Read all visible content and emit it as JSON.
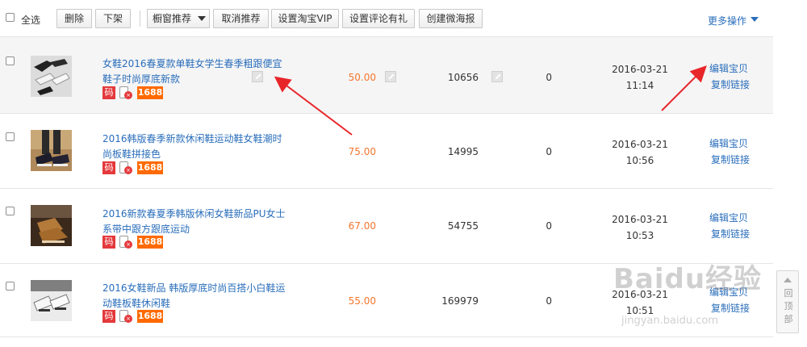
{
  "toolbar": {
    "select_all": "全选",
    "buttons": [
      "删除",
      "下架",
      "橱窗推荐",
      "取消推荐",
      "设置淘宝VIP",
      "设置评论有礼",
      "创建微海报"
    ],
    "more": "更多操作"
  },
  "badges": {
    "ma": "码",
    "x": "×",
    "b1688": "1688"
  },
  "rows": [
    {
      "title": "女鞋2016春夏款单鞋女学生春季粗跟便宜鞋子时尚厚底新款",
      "price": "50.00",
      "stock": "10656",
      "sales": "0",
      "date": "2016-03-21",
      "time": "11:14",
      "edit": "编辑宝贝",
      "copy": "复制链接"
    },
    {
      "title": "2016韩版春季新款休闲鞋运动鞋女鞋潮时尚板鞋拼接色",
      "price": "75.00",
      "stock": "14995",
      "sales": "0",
      "date": "2016-03-21",
      "time": "10:56",
      "edit": "编辑宝贝",
      "copy": "复制链接"
    },
    {
      "title": "2016新款春夏季韩版休闲女鞋新品PU女士系带中跟方跟底运动",
      "price": "67.00",
      "stock": "54755",
      "sales": "0",
      "date": "2016-03-21",
      "time": "10:53",
      "edit": "编辑宝贝",
      "copy": "复制链接"
    },
    {
      "title": "2016女鞋新品 韩版厚底时尚百搭小白鞋运动鞋板鞋休闲鞋",
      "price": "55.00",
      "stock": "169979",
      "sales": "0",
      "date": "2016-03-21",
      "time": "10:51",
      "edit": "编辑宝贝",
      "copy": "复制链接"
    }
  ],
  "backtop": "回顶部",
  "watermark": {
    "main": "Baidu经验",
    "url": "jingyan.baidu.com"
  },
  "colors": {
    "link": "#2a6ebb",
    "price": "#f5762d",
    "badge_red": "#e4393c",
    "badge_orange": "#ff6a00",
    "arrow": "#e8262a"
  }
}
